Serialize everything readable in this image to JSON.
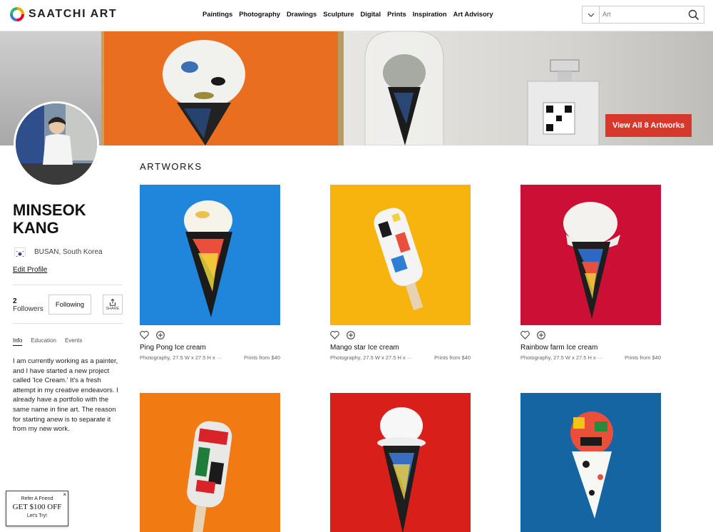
{
  "header": {
    "logo_text": "SAATCHI ART",
    "nav": [
      "Paintings",
      "Photography",
      "Drawings",
      "Sculpture",
      "Digital",
      "Prints",
      "Inspiration",
      "Art Advisory"
    ],
    "search_placeholder": "Art"
  },
  "banner": {
    "view_all_label": "View All 8 Artworks"
  },
  "profile": {
    "name": "MINSEOK KANG",
    "location": "BUSAN, South Korea",
    "edit_label": "Edit Profile",
    "followers_count": "2",
    "followers_label": "Followers",
    "following_label": "Following",
    "share_label": "SHARE",
    "tabs": [
      "Info",
      "Education",
      "Events"
    ],
    "bio": "I am currently working as a painter, and I have started a new project called 'Ice Cream.' It's a fresh attempt in my creative endeavors. I already have a portfolio with the same name in fine art. The reason for starting anew is to separate it from my new work."
  },
  "refer": {
    "line1": "Refer A Friend",
    "line2": "GET $100 OFF",
    "line3": "Let's Try!",
    "close": "×"
  },
  "artworks": {
    "section_title": "ARTWORKS",
    "items": [
      {
        "title": "Ping Pong Ice cream",
        "meta": "Photography, 27.5 W x 27.5 H x ···",
        "price": "Prints from $40",
        "bg": "#1f86dc"
      },
      {
        "title": "Mango star Ice cream",
        "meta": "Photography, 27.5 W x 27.5 H x ···",
        "price": "Prints from $40",
        "bg": "#f7b40f"
      },
      {
        "title": "Rainbow farm Ice cream",
        "meta": "Photography, 27.5 W x 27.5 H x ···",
        "price": "Prints from $40",
        "bg": "#cc0f35"
      },
      {
        "title": "",
        "meta": "",
        "price": "",
        "bg": "#f27a12"
      },
      {
        "title": "",
        "meta": "",
        "price": "",
        "bg": "#d91f1a"
      },
      {
        "title": "",
        "meta": "",
        "price": "",
        "bg": "#1565a3"
      }
    ]
  },
  "colors": {
    "accent": "#d6382b"
  }
}
